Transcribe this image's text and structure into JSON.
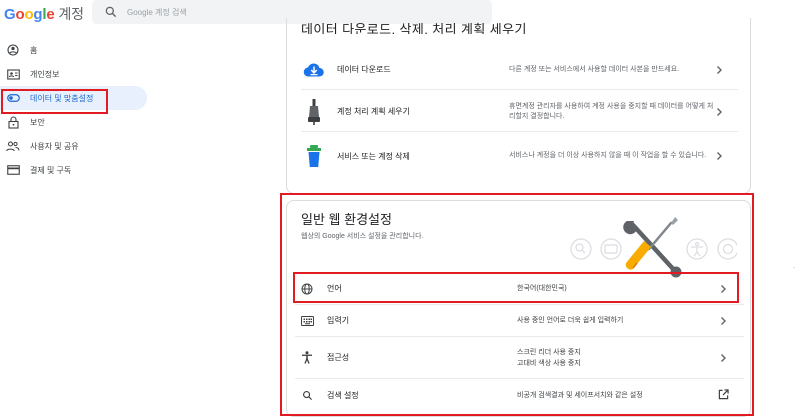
{
  "header": {
    "logo_google": [
      "G",
      "o",
      "o",
      "g",
      "l",
      "e"
    ],
    "product": "계정",
    "search_placeholder": "Google 계정 검색"
  },
  "sidebar": {
    "items": [
      {
        "label": "홈",
        "icon": "account-circle-icon"
      },
      {
        "label": "개인정보",
        "icon": "id-card-icon"
      },
      {
        "label": "데이터 및 맞춤설정",
        "icon": "toggle-icon",
        "active": true
      },
      {
        "label": "보안",
        "icon": "lock-icon"
      },
      {
        "label": "사용자 및 공유",
        "icon": "people-icon"
      },
      {
        "label": "결제 및 구독",
        "icon": "credit-card-icon"
      }
    ]
  },
  "data_section": {
    "title": "데이터 다운로드, 삭제, 처리 계획 세우기",
    "rows": [
      {
        "label": "데이터 다운로드",
        "desc": "다른 계정 또는 서비스에서 사용할 데이터 사본을 만드세요.",
        "icon": "cloud-download-icon"
      },
      {
        "label": "계정 처리 계획 세우기",
        "desc": "휴면계정 관리자를 사용하여 계정 사용을 중지할 때 데이터를 어떻게 처리할지 결정합니다.",
        "icon": "plug-icon"
      },
      {
        "label": "서비스 또는 계정 삭제",
        "desc": "서비스나 계정을 더 이상 사용하지 않을 때 이 작업을 할 수 있습니다.",
        "icon": "trash-icon"
      }
    ]
  },
  "web_prefs": {
    "title": "일반 웹 환경설정",
    "subtitle": "웹상의 Google 서비스 설정을 관리합니다.",
    "rows": [
      {
        "label": "언어",
        "value_line1": "한국어(대한민국)",
        "value_line2": "",
        "icon": "globe-icon",
        "action": "chevron-right-icon"
      },
      {
        "label": "입력기",
        "value_line1": "사용 중인 언어로 더욱 쉽게 입력하기",
        "value_line2": "",
        "icon": "keyboard-icon",
        "action": "chevron-right-icon"
      },
      {
        "label": "접근성",
        "value_line1": "스크린 리더 사용 중지",
        "value_line2": "고대비 색상 사용 중지",
        "icon": "accessibility-icon",
        "action": "chevron-right-icon"
      },
      {
        "label": "검색 설정",
        "value_line1": "비공개 검색결과 및 세이프서치와 같은 설정",
        "value_line2": "",
        "icon": "search-icon",
        "action": "open-in-new-icon"
      }
    ]
  },
  "colors": {
    "highlight": "#e21b23",
    "active_bg": "#e8f0fe",
    "active_text": "#1967d2",
    "tool_yellow": "#f9ab00"
  }
}
